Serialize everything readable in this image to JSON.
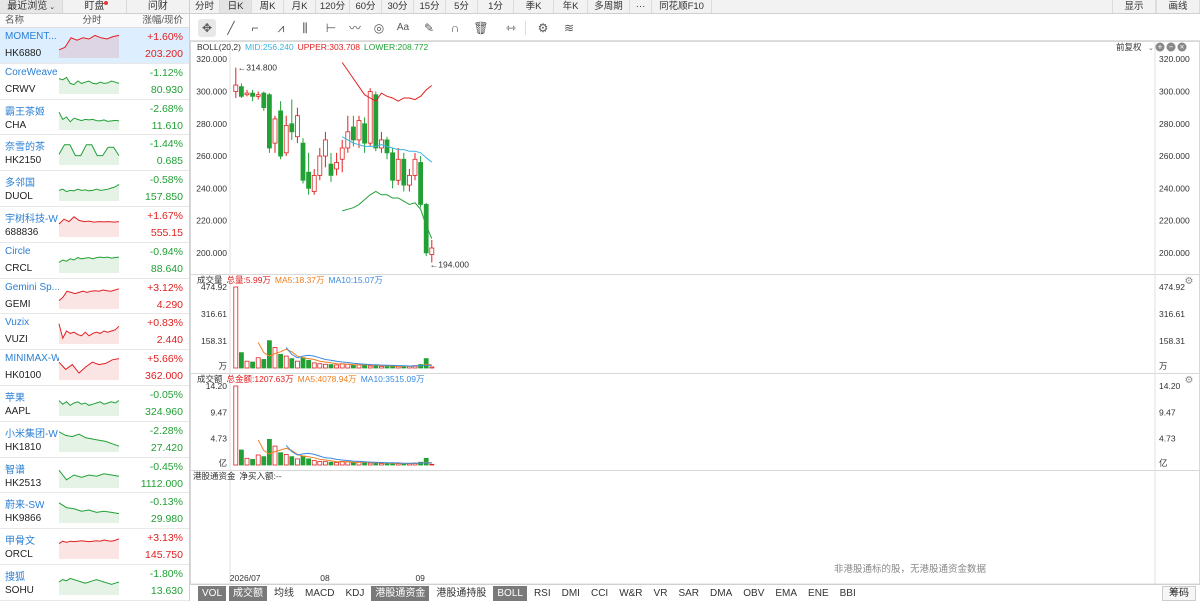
{
  "left_panel": {
    "tabs": [
      {
        "label": "最近浏览"
      },
      {
        "label": "盯盘",
        "has_dot": true
      },
      {
        "label": "问财"
      }
    ],
    "columns": {
      "name": "名称",
      "chart": "分时",
      "change": "涨幅/现价"
    },
    "stocks": [
      {
        "name": "MOMENT...",
        "code": "HK6880",
        "change": "+1.60%",
        "price": "203.200",
        "dir": "up",
        "selected": true,
        "spark": [
          0.7,
          0.6,
          0.2,
          0.3,
          0.2,
          0.25,
          0.1,
          0.2,
          0.25,
          0.15,
          0.1
        ]
      },
      {
        "name": "CoreWeave",
        "code": "CRWV",
        "change": "-1.12%",
        "price": "80.930",
        "dir": "dn",
        "spark": [
          0.4,
          0.45,
          0.35,
          0.6,
          0.65,
          0.5,
          0.6,
          0.55,
          0.5,
          0.6,
          0.62,
          0.55,
          0.6,
          0.58,
          0.5,
          0.55,
          0.6
        ]
      },
      {
        "name": "霸王茶姬",
        "code": "CHA",
        "change": "-2.68%",
        "price": "11.610",
        "dir": "dn",
        "spark": [
          0.3,
          0.6,
          0.5,
          0.7,
          0.55,
          0.6,
          0.65,
          0.6,
          0.62,
          0.6,
          0.65,
          0.66,
          0.62,
          0.68,
          0.66,
          0.64,
          0.66
        ]
      },
      {
        "name": "奈雪的茶",
        "code": "HK2150",
        "change": "-1.44%",
        "price": "0.685",
        "dir": "dn",
        "spark": [
          0.6,
          0.2,
          0.2,
          0.65,
          0.65,
          0.2,
          0.2,
          0.65,
          0.65,
          0.3,
          0.3,
          0.65
        ]
      },
      {
        "name": "多邻国",
        "code": "DUOL",
        "change": "-0.58%",
        "price": "157.850",
        "dir": "dn",
        "spark": [
          0.6,
          0.55,
          0.65,
          0.6,
          0.62,
          0.55,
          0.6,
          0.58,
          0.62,
          0.6,
          0.55,
          0.6,
          0.58,
          0.55,
          0.5,
          0.45,
          0.35
        ]
      },
      {
        "name": "宇树科技-W",
        "code": "688836",
        "change": "+1.67%",
        "price": "555.15",
        "dir": "up",
        "spark": [
          0.5,
          0.3,
          0.4,
          0.2,
          0.35,
          0.4,
          0.38,
          0.42,
          0.4,
          0.41,
          0.4,
          0.42,
          0.4
        ]
      },
      {
        "name": "Circle",
        "code": "CRCL",
        "change": "-0.94%",
        "price": "88.640",
        "dir": "dn",
        "spark": [
          0.6,
          0.5,
          0.55,
          0.45,
          0.5,
          0.4,
          0.45,
          0.42,
          0.4,
          0.45,
          0.4,
          0.38,
          0.4,
          0.38,
          0.42,
          0.4,
          0.38
        ]
      },
      {
        "name": "Gemini Sp...",
        "code": "GEMI",
        "change": "+3.12%",
        "price": "4.290",
        "dir": "up",
        "spark": [
          0.7,
          0.55,
          0.3,
          0.35,
          0.4,
          0.35,
          0.3,
          0.35,
          0.3,
          0.28,
          0.3,
          0.25,
          0.28,
          0.3,
          0.25,
          0.2
        ]
      },
      {
        "name": "Vuzix",
        "code": "VUZI",
        "change": "+0.83%",
        "price": "2.440",
        "dir": "up",
        "spark": [
          0.2,
          0.8,
          0.5,
          0.6,
          0.55,
          0.65,
          0.7,
          0.55,
          0.7,
          0.6,
          0.55,
          0.6,
          0.5,
          0.55,
          0.5,
          0.45,
          0.3
        ]
      },
      {
        "name": "MINIMAX-W",
        "code": "HK0100",
        "change": "+5.66%",
        "price": "362.000",
        "dir": "up",
        "spark": [
          0.3,
          0.6,
          0.4,
          0.75,
          0.5,
          0.3,
          0.4,
          0.35,
          0.2,
          0.15
        ]
      },
      {
        "name": "苹果",
        "code": "AAPL",
        "change": "-0.05%",
        "price": "324.960",
        "dir": "dn",
        "spark": [
          0.4,
          0.55,
          0.45,
          0.6,
          0.5,
          0.45,
          0.55,
          0.5,
          0.6,
          0.55,
          0.5,
          0.45,
          0.55,
          0.5,
          0.45,
          0.5,
          0.4
        ]
      },
      {
        "name": "小米集团-W",
        "code": "HK1810",
        "change": "-2.28%",
        "price": "27.420",
        "dir": "dn",
        "spark": [
          0.2,
          0.35,
          0.4,
          0.3,
          0.45,
          0.5,
          0.55,
          0.6,
          0.7,
          0.8
        ]
      },
      {
        "name": "智谱",
        "code": "HK2513",
        "change": "-0.45%",
        "price": "1112.000",
        "dir": "dn",
        "spark": [
          0.3,
          0.7,
          0.5,
          0.6,
          0.5,
          0.55,
          0.45,
          0.5,
          0.55
        ]
      },
      {
        "name": "蔚来-SW",
        "code": "HK9866",
        "change": "-0.13%",
        "price": "29.980",
        "dir": "dn",
        "spark": [
          0.2,
          0.4,
          0.45,
          0.55,
          0.5,
          0.6,
          0.55,
          0.6,
          0.65
        ]
      },
      {
        "name": "甲骨文",
        "code": "ORCL",
        "change": "+3.13%",
        "price": "145.750",
        "dir": "up",
        "spark": [
          0.4,
          0.3,
          0.35,
          0.3,
          0.32,
          0.3,
          0.28,
          0.3,
          0.32,
          0.3,
          0.28,
          0.3,
          0.25,
          0.28,
          0.3,
          0.26,
          0.2
        ]
      },
      {
        "name": "搜狐",
        "code": "SOHU",
        "change": "-1.80%",
        "price": "13.630",
        "dir": "dn",
        "spark": [
          0.5,
          0.4,
          0.45,
          0.35,
          0.4,
          0.45,
          0.5,
          0.55,
          0.5,
          0.45,
          0.4,
          0.45,
          0.5,
          0.55,
          0.6,
          0.55,
          0.5
        ]
      }
    ]
  },
  "top_tabs": [
    "分时",
    "日K",
    "周K",
    "月K",
    "120分",
    "60分",
    "30分",
    "15分",
    "5分",
    "1分",
    "季K",
    "年K",
    "多周期",
    "···",
    "同花顺F10"
  ],
  "active_top_tab": 1,
  "top_right": [
    "显示",
    "画线"
  ],
  "tools": [
    "crosshair-icon",
    "line-icon",
    "crop-icon",
    "fan-icon",
    "columns-icon",
    "ruler-icon",
    "wave-icon",
    "cycle-icon",
    "text-icon",
    "pen-icon",
    "magnet-icon",
    "trash-icon",
    "arrows-icon",
    "gear-icon",
    "layers-icon"
  ],
  "main_panel": {
    "indicator": "BOLL(20,2)",
    "mid": "MID:256.240",
    "upper": "UPPER:303.708",
    "lower": "LOWER:208.772",
    "adjust": "前复权",
    "y_ticks": [
      "320.000",
      "300.000",
      "280.000",
      "260.000",
      "240.000",
      "220.000",
      "200.000"
    ],
    "high_label": "314.800",
    "low_label": "194.000"
  },
  "volume_panel": {
    "title": "成交量",
    "total": "总量:5.99万",
    "ma5": "MA5:18.37万",
    "ma10": "MA10:15.07万",
    "y_ticks": [
      "474.92",
      "316.61",
      "158.31"
    ],
    "unit": "万"
  },
  "amount_panel": {
    "title": "成交额",
    "total": "总金额:1207.63万",
    "ma5": "MA5:4078.94万",
    "ma10": "MA10:3515.09万",
    "y_ticks": [
      "14.20",
      "9.47",
      "4.73"
    ],
    "unit": "亿"
  },
  "hk_panel": {
    "title": "港股通资金",
    "net": "净买入额:--",
    "no_data": "非港股通标的股，无港股通资金数据"
  },
  "x_labels": [
    "2026/07",
    "08",
    "09"
  ],
  "bottom_bar": {
    "items": [
      "VOL",
      "成交额",
      "均线",
      "MACD",
      "KDJ",
      "港股通资金",
      "港股通持股",
      "BOLL",
      "RSI",
      "DMI",
      "CCI",
      "W&R",
      "VR",
      "SAR",
      "DMA",
      "OBV",
      "EMA",
      "ENE",
      "BBI"
    ],
    "active": [
      "VOL",
      "成交额",
      "港股通资金",
      "BOLL"
    ],
    "chip": "筹码"
  },
  "colors": {
    "up": "#e02020",
    "down": "#22a035",
    "mid": "#3bb3e0",
    "upper": "#e02020",
    "lower": "#22a035",
    "ma5": "#f08020",
    "ma10": "#3b8be0"
  },
  "chart_data": {
    "type": "candlestick",
    "ylim": [
      190,
      322
    ],
    "candles": [
      {
        "o": 300,
        "h": 314.8,
        "l": 296,
        "c": 304
      },
      {
        "o": 303,
        "h": 305,
        "l": 296,
        "c": 297
      },
      {
        "o": 298,
        "h": 301,
        "l": 297,
        "c": 299
      },
      {
        "o": 299,
        "h": 301,
        "l": 294,
        "c": 297
      },
      {
        "o": 297,
        "h": 300,
        "l": 295,
        "c": 298
      },
      {
        "o": 299,
        "h": 300,
        "l": 288,
        "c": 290
      },
      {
        "o": 298,
        "h": 299,
        "l": 262,
        "c": 265
      },
      {
        "o": 268,
        "h": 285,
        "l": 262,
        "c": 283
      },
      {
        "o": 288,
        "h": 294,
        "l": 258,
        "c": 260
      },
      {
        "o": 262,
        "h": 285,
        "l": 260,
        "c": 279
      },
      {
        "o": 280,
        "h": 295,
        "l": 270,
        "c": 275
      },
      {
        "o": 272,
        "h": 290,
        "l": 268,
        "c": 285
      },
      {
        "o": 268,
        "h": 271,
        "l": 243,
        "c": 245
      },
      {
        "o": 250,
        "h": 262,
        "l": 236,
        "c": 240
      },
      {
        "o": 238,
        "h": 252,
        "l": 236,
        "c": 248
      },
      {
        "o": 248,
        "h": 265,
        "l": 245,
        "c": 260
      },
      {
        "o": 260,
        "h": 275,
        "l": 253,
        "c": 270
      },
      {
        "o": 255,
        "h": 262,
        "l": 244,
        "c": 248
      },
      {
        "o": 252,
        "h": 262,
        "l": 248,
        "c": 256
      },
      {
        "o": 258,
        "h": 270,
        "l": 250,
        "c": 265
      },
      {
        "o": 265,
        "h": 285,
        "l": 262,
        "c": 275
      },
      {
        "o": 278,
        "h": 285,
        "l": 266,
        "c": 270
      },
      {
        "o": 270,
        "h": 285,
        "l": 265,
        "c": 282
      },
      {
        "o": 280,
        "h": 284,
        "l": 262,
        "c": 268
      },
      {
        "o": 268,
        "h": 302,
        "l": 266,
        "c": 300
      },
      {
        "o": 298,
        "h": 300,
        "l": 263,
        "c": 265
      },
      {
        "o": 265,
        "h": 275,
        "l": 262,
        "c": 270
      },
      {
        "o": 270,
        "h": 272,
        "l": 258,
        "c": 262
      },
      {
        "o": 262,
        "h": 265,
        "l": 240,
        "c": 245
      },
      {
        "o": 245,
        "h": 265,
        "l": 242,
        "c": 258
      },
      {
        "o": 258,
        "h": 262,
        "l": 238,
        "c": 242
      },
      {
        "o": 242,
        "h": 252,
        "l": 238,
        "c": 248
      },
      {
        "o": 248,
        "h": 262,
        "l": 245,
        "c": 258
      },
      {
        "o": 256,
        "h": 260,
        "l": 228,
        "c": 230
      },
      {
        "o": 230,
        "h": 231,
        "l": 198,
        "c": 200
      },
      {
        "o": 199,
        "h": 208,
        "l": 194,
        "c": 203
      }
    ],
    "boll_upper": [
      null,
      null,
      null,
      null,
      null,
      null,
      null,
      null,
      null,
      null,
      null,
      null,
      null,
      null,
      null,
      null,
      null,
      null,
      null,
      318,
      313,
      308,
      303,
      298,
      296,
      294,
      299,
      297,
      296,
      294,
      296,
      296,
      295,
      297,
      301,
      303.7
    ],
    "boll_mid": [
      null,
      null,
      null,
      null,
      null,
      null,
      null,
      null,
      null,
      null,
      null,
      null,
      null,
      null,
      null,
      null,
      null,
      null,
      null,
      272,
      270,
      268,
      267,
      266,
      266,
      266,
      267,
      266,
      265,
      264,
      264,
      263,
      263,
      262,
      259,
      256.2
    ],
    "boll_lower": [
      null,
      null,
      null,
      null,
      null,
      null,
      null,
      null,
      null,
      null,
      null,
      null,
      null,
      null,
      null,
      null,
      null,
      null,
      null,
      226,
      227,
      228,
      230,
      233,
      236,
      238,
      236,
      236,
      234,
      234,
      232,
      230,
      231,
      227,
      217,
      208.8
    ],
    "volume": [
      474.92,
      90,
      40,
      35,
      60,
      50,
      160,
      120,
      80,
      70,
      55,
      40,
      60,
      45,
      30,
      25,
      22,
      20,
      18,
      25,
      22,
      15,
      18,
      20,
      12,
      15,
      10,
      9,
      12,
      10,
      8,
      10,
      14,
      20,
      55,
      6
    ],
    "volume_ma5": [
      null,
      null,
      null,
      null,
      150,
      90,
      70,
      85,
      95,
      110,
      95,
      70,
      60,
      55,
      50,
      40,
      35,
      30,
      25,
      24,
      22,
      20,
      19,
      18,
      18,
      16,
      15,
      13,
      12,
      11,
      10,
      10,
      11,
      12,
      21,
      18.37
    ],
    "volume_ma10": [
      null,
      null,
      null,
      null,
      null,
      null,
      null,
      null,
      null,
      120,
      80,
      60,
      70,
      75,
      70,
      60,
      50,
      45,
      40,
      35,
      32,
      28,
      25,
      22,
      20,
      19,
      17,
      16,
      15,
      14,
      13,
      12,
      12,
      13,
      16,
      15.07
    ],
    "amount": [
      14.2,
      2.7,
      1.2,
      1.0,
      1.8,
      1.5,
      4.6,
      3.4,
      2.2,
      1.9,
      1.5,
      1.1,
      1.6,
      1.1,
      0.8,
      0.65,
      0.6,
      0.5,
      0.45,
      0.65,
      0.6,
      0.4,
      0.5,
      0.55,
      0.35,
      0.4,
      0.27,
      0.24,
      0.3,
      0.25,
      0.2,
      0.25,
      0.35,
      0.5,
      1.2,
      0.12
    ],
    "amount_ma5": [
      null,
      null,
      null,
      null,
      4.5,
      2.6,
      2.0,
      2.4,
      2.7,
      3.0,
      2.6,
      1.9,
      1.6,
      1.5,
      1.3,
      1.0,
      0.9,
      0.75,
      0.6,
      0.6,
      0.55,
      0.5,
      0.5,
      0.5,
      0.48,
      0.42,
      0.4,
      0.35,
      0.32,
      0.3,
      0.26,
      0.26,
      0.27,
      0.3,
      0.5,
      0.41
    ],
    "amount_ma10": [
      null,
      null,
      null,
      null,
      null,
      null,
      null,
      null,
      null,
      3.5,
      2.4,
      1.8,
      2.0,
      2.1,
      1.9,
      1.6,
      1.3,
      1.2,
      1.0,
      0.9,
      0.8,
      0.7,
      0.65,
      0.58,
      0.52,
      0.5,
      0.45,
      0.42,
      0.4,
      0.37,
      0.33,
      0.3,
      0.3,
      0.32,
      0.4,
      0.35
    ]
  }
}
